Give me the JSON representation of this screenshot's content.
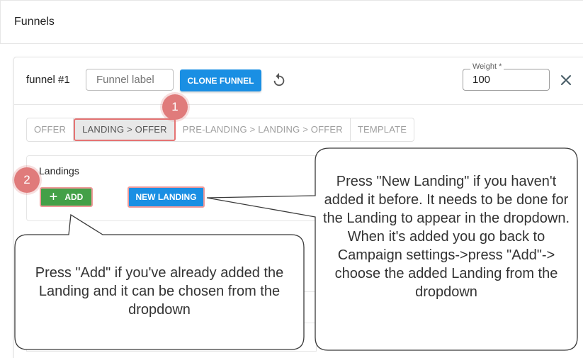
{
  "page": {
    "title": "Funnels"
  },
  "funnel": {
    "name": "funnel #1",
    "label_placeholder": "Funnel label",
    "clone_label": "CLONE FUNNEL",
    "weight_label": "Weight *",
    "weight_value": "100"
  },
  "tabs": [
    {
      "label": "OFFER",
      "active": false
    },
    {
      "label": "LANDING > OFFER",
      "active": true
    },
    {
      "label": "PRE-LANDING > LANDING > OFFER",
      "active": false
    },
    {
      "label": "TEMPLATE",
      "active": false
    }
  ],
  "landings": {
    "title": "Landings",
    "add_label": "ADD",
    "new_landing_label": "NEW LANDING"
  },
  "annotations": {
    "badge_1": "1",
    "badge_2": "2",
    "callout_add": "Press \"Add\" if you've already added the Landing and it can be chosen from the dropdown",
    "callout_new": "Press \"New Landing\" if you haven't added it before. It needs to be done for the Landing to appear in the dropdown. When it's added you go back to Campaign settings->press \"Add\"-> choose the added Landing from the dropdown"
  },
  "colors": {
    "primary": "#1a8fe3",
    "success": "#43a047",
    "highlight": "#e07b7b"
  },
  "icons": {
    "refresh": "refresh-icon",
    "close": "close-icon",
    "plus": "plus-icon"
  }
}
